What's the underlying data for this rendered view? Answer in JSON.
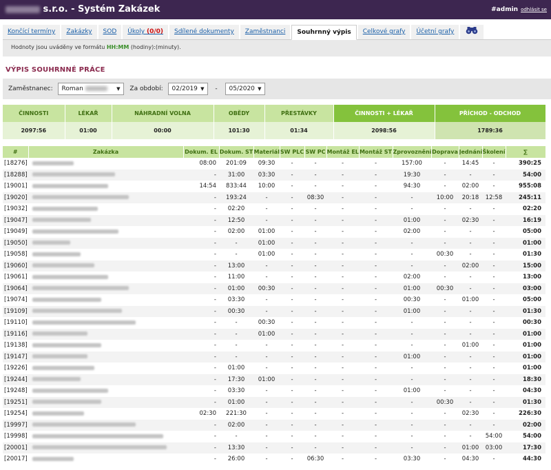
{
  "header": {
    "title": "s.r.o. - Systém Zakázek",
    "user": "#admin",
    "logout": "odhlásit se"
  },
  "tabs": [
    {
      "label": "Končící termíny"
    },
    {
      "label": "Zakázky"
    },
    {
      "label": "SOD"
    },
    {
      "label": "Úkoly",
      "badge": "(0/0)"
    },
    {
      "label": "Sdílené dokumenty"
    },
    {
      "label": "Zaměstnanci"
    },
    {
      "label": "Souhrnný výpis"
    },
    {
      "label": "Celkové grafy"
    },
    {
      "label": "Účetní grafy"
    }
  ],
  "note": {
    "text": "Hodnoty jsou uváděny ve formátu ",
    "format": "HH:MM",
    "suffix": " (hodiny):(minuty)."
  },
  "section_title": "VÝPIS SOUHRNNÉ PRÁCE",
  "filter": {
    "employee_label": "Zaměstnanec:",
    "employee_value": "Roman",
    "period_label": "Za období:",
    "from": "02/2019",
    "dash": "-",
    "to": "05/2020"
  },
  "summary": {
    "headers": [
      "ČINNOSTI",
      "LÉKAŘ",
      "NÁHRADNÍ VOLNA",
      "OBĚDY",
      "PŘESTÁVKY",
      "ČINNOSTI + LÉKAŘ",
      "PŘÍCHOD - ODCHOD"
    ],
    "values": [
      "2097:56",
      "01:00",
      "00:00",
      "101:30",
      "01:34",
      "2098:56",
      "1789:36"
    ]
  },
  "detail": {
    "headers": [
      "#",
      "Zakázka",
      "Dokum. EL",
      "Dokum. ST",
      "Materiál",
      "SW PLC",
      "SW PC",
      "Montáž EL",
      "Montáž ST",
      "Zprovoznění",
      "Doprava",
      "Jednání",
      "Školení",
      "∑"
    ],
    "rows": [
      [
        "[18276]",
        "08:00",
        "201:09",
        "09:30",
        "-",
        "-",
        "-",
        "-",
        "157:00",
        "-",
        "14:45",
        "-",
        "390:25"
      ],
      [
        "[18288]",
        "-",
        "31:00",
        "03:30",
        "-",
        "-",
        "-",
        "-",
        "19:30",
        "-",
        "-",
        "-",
        "54:00"
      ],
      [
        "[19001]",
        "14:54",
        "833:44",
        "10:00",
        "-",
        "-",
        "-",
        "-",
        "94:30",
        "-",
        "02:00",
        "-",
        "955:08"
      ],
      [
        "[19020]",
        "-",
        "193:24",
        "-",
        "-",
        "08:30",
        "-",
        "-",
        "-",
        "10:00",
        "20:18",
        "12:58",
        "245:11"
      ],
      [
        "[19032]",
        "-",
        "02:20",
        "-",
        "-",
        "-",
        "-",
        "-",
        "-",
        "-",
        "-",
        "-",
        "02:20"
      ],
      [
        "[19047]",
        "-",
        "12:50",
        "-",
        "-",
        "-",
        "-",
        "-",
        "01:00",
        "-",
        "02:30",
        "-",
        "16:19"
      ],
      [
        "[19049]",
        "-",
        "02:00",
        "01:00",
        "-",
        "-",
        "-",
        "-",
        "02:00",
        "-",
        "-",
        "-",
        "05:00"
      ],
      [
        "[19050]",
        "-",
        "-",
        "01:00",
        "-",
        "-",
        "-",
        "-",
        "-",
        "-",
        "-",
        "-",
        "01:00"
      ],
      [
        "[19058]",
        "-",
        "-",
        "01:00",
        "-",
        "-",
        "-",
        "-",
        "-",
        "00:30",
        "-",
        "-",
        "01:30"
      ],
      [
        "[19060]",
        "-",
        "13:00",
        "-",
        "-",
        "-",
        "-",
        "-",
        "-",
        "-",
        "02:00",
        "-",
        "15:00"
      ],
      [
        "[19061]",
        "-",
        "11:00",
        "-",
        "-",
        "-",
        "-",
        "-",
        "02:00",
        "-",
        "-",
        "-",
        "13:00"
      ],
      [
        "[19064]",
        "-",
        "01:00",
        "00:30",
        "-",
        "-",
        "-",
        "-",
        "01:00",
        "00:30",
        "-",
        "-",
        "03:00"
      ],
      [
        "[19074]",
        "-",
        "03:30",
        "-",
        "-",
        "-",
        "-",
        "-",
        "00:30",
        "-",
        "01:00",
        "-",
        "05:00"
      ],
      [
        "[19109]",
        "-",
        "00:30",
        "-",
        "-",
        "-",
        "-",
        "-",
        "01:00",
        "-",
        "-",
        "-",
        "01:30"
      ],
      [
        "[19110]",
        "-",
        "-",
        "00:30",
        "-",
        "-",
        "-",
        "-",
        "-",
        "-",
        "-",
        "-",
        "00:30"
      ],
      [
        "[19116]",
        "-",
        "-",
        "01:00",
        "-",
        "-",
        "-",
        "-",
        "-",
        "-",
        "-",
        "-",
        "01:00"
      ],
      [
        "[19138]",
        "-",
        "-",
        "-",
        "-",
        "-",
        "-",
        "-",
        "-",
        "-",
        "01:00",
        "-",
        "01:00"
      ],
      [
        "[19147]",
        "-",
        "-",
        "-",
        "-",
        "-",
        "-",
        "-",
        "01:00",
        "-",
        "-",
        "-",
        "01:00"
      ],
      [
        "[19226]",
        "-",
        "01:00",
        "-",
        "-",
        "-",
        "-",
        "-",
        "-",
        "-",
        "-",
        "-",
        "01:00"
      ],
      [
        "[19244]",
        "-",
        "17:30",
        "01:00",
        "-",
        "-",
        "-",
        "-",
        "-",
        "-",
        "-",
        "-",
        "18:30"
      ],
      [
        "[19248]",
        "-",
        "03:30",
        "-",
        "-",
        "-",
        "-",
        "-",
        "01:00",
        "-",
        "-",
        "-",
        "04:30"
      ],
      [
        "[19251]",
        "-",
        "01:00",
        "-",
        "-",
        "-",
        "-",
        "-",
        "-",
        "00:30",
        "-",
        "-",
        "01:30"
      ],
      [
        "[19254]",
        "02:30",
        "221:30",
        "-",
        "-",
        "-",
        "-",
        "-",
        "-",
        "-",
        "02:30",
        "-",
        "226:30"
      ],
      [
        "[19997]",
        "-",
        "02:00",
        "-",
        "-",
        "-",
        "-",
        "-",
        "-",
        "-",
        "-",
        "-",
        "02:00"
      ],
      [
        "[19998]",
        "-",
        "-",
        "-",
        "-",
        "-",
        "-",
        "-",
        "-",
        "-",
        "-",
        "54:00",
        "54:00"
      ],
      [
        "[20001]",
        "-",
        "13:30",
        "-",
        "-",
        "-",
        "-",
        "-",
        "-",
        "-",
        "01:00",
        "03:00",
        "17:30"
      ],
      [
        "[20017]",
        "-",
        "26:00",
        "-",
        "-",
        "06:30",
        "-",
        "-",
        "03:30",
        "-",
        "04:30",
        "-",
        "44:30"
      ]
    ]
  }
}
